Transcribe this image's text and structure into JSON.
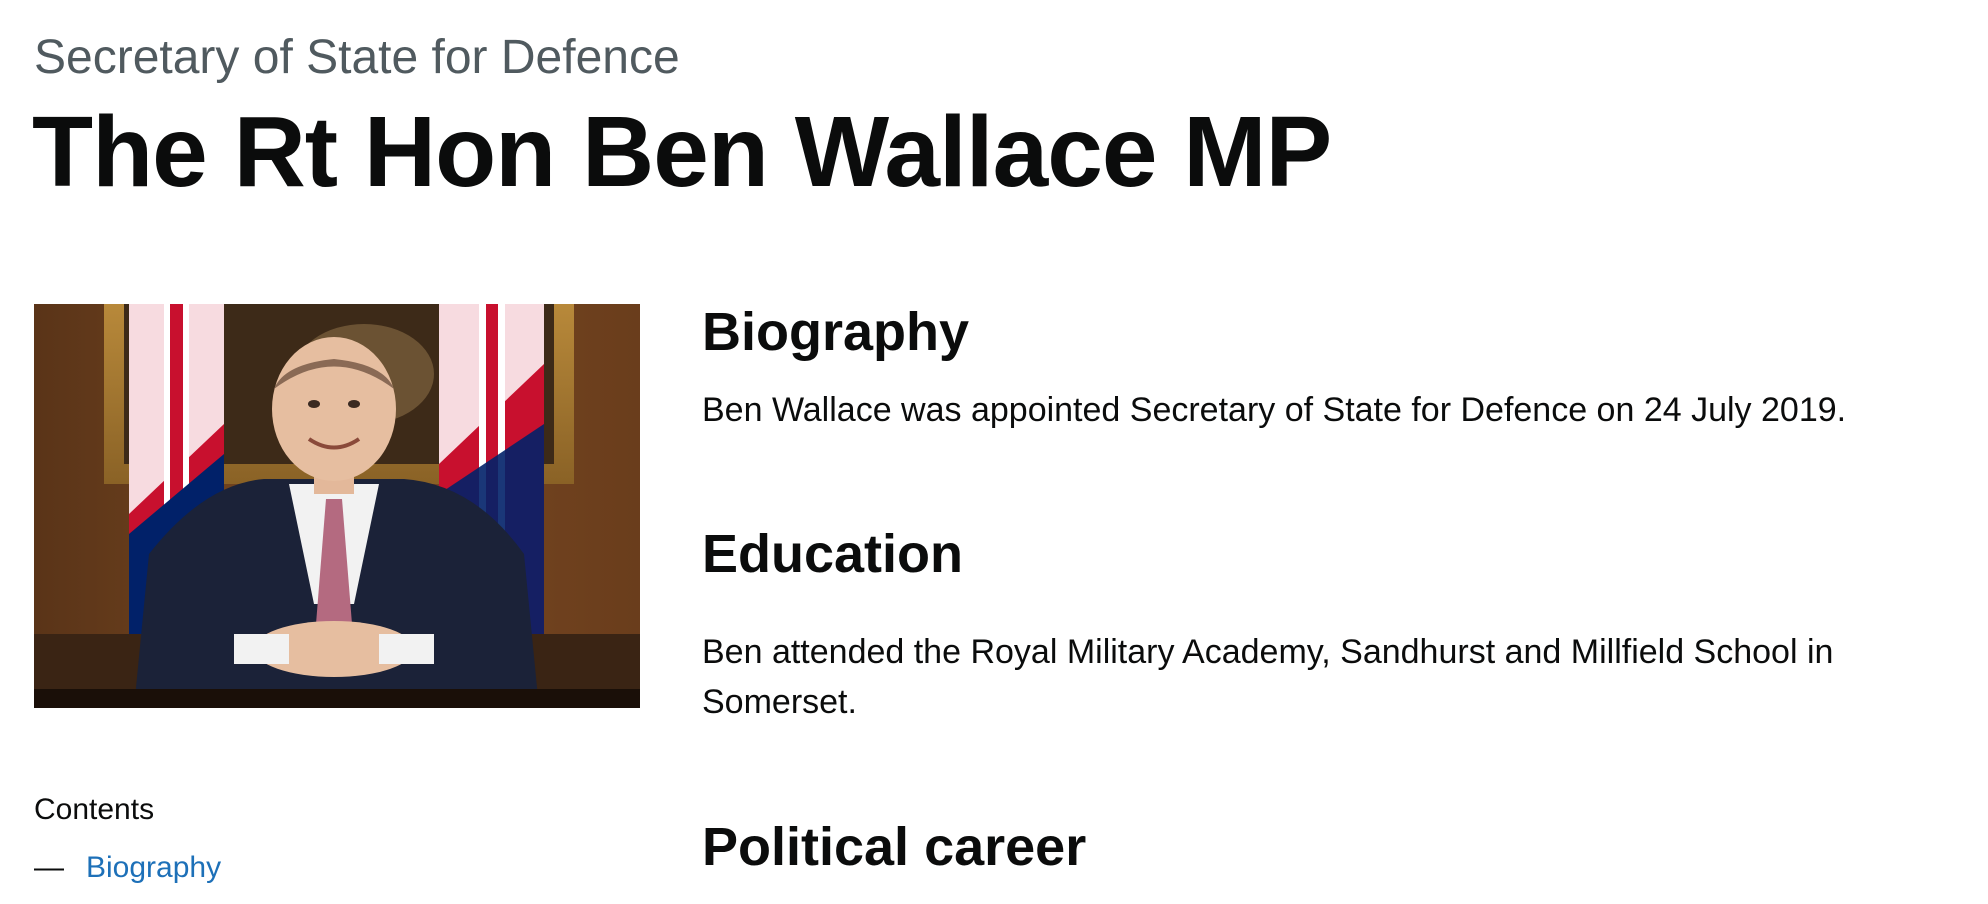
{
  "header": {
    "role": "Secretary of State for Defence",
    "name": "The Rt Hon Ben Wallace MP"
  },
  "sidebar": {
    "contents_title": "Contents",
    "contents_items": [
      {
        "dash": "—",
        "label": "Biography"
      }
    ]
  },
  "sections": {
    "biography": {
      "heading": "Biography",
      "body": "Ben Wallace was appointed Secretary of State for Defence on 24 July 2019."
    },
    "education": {
      "heading": "Education",
      "body": "Ben attended the Royal Military Academy, Sandhurst and Millfield School in Somerset."
    },
    "political_career": {
      "heading": "Political career"
    }
  },
  "colors": {
    "link": "#1d70b8",
    "text": "#0b0c0c",
    "secondary_text": "#505a5f"
  }
}
